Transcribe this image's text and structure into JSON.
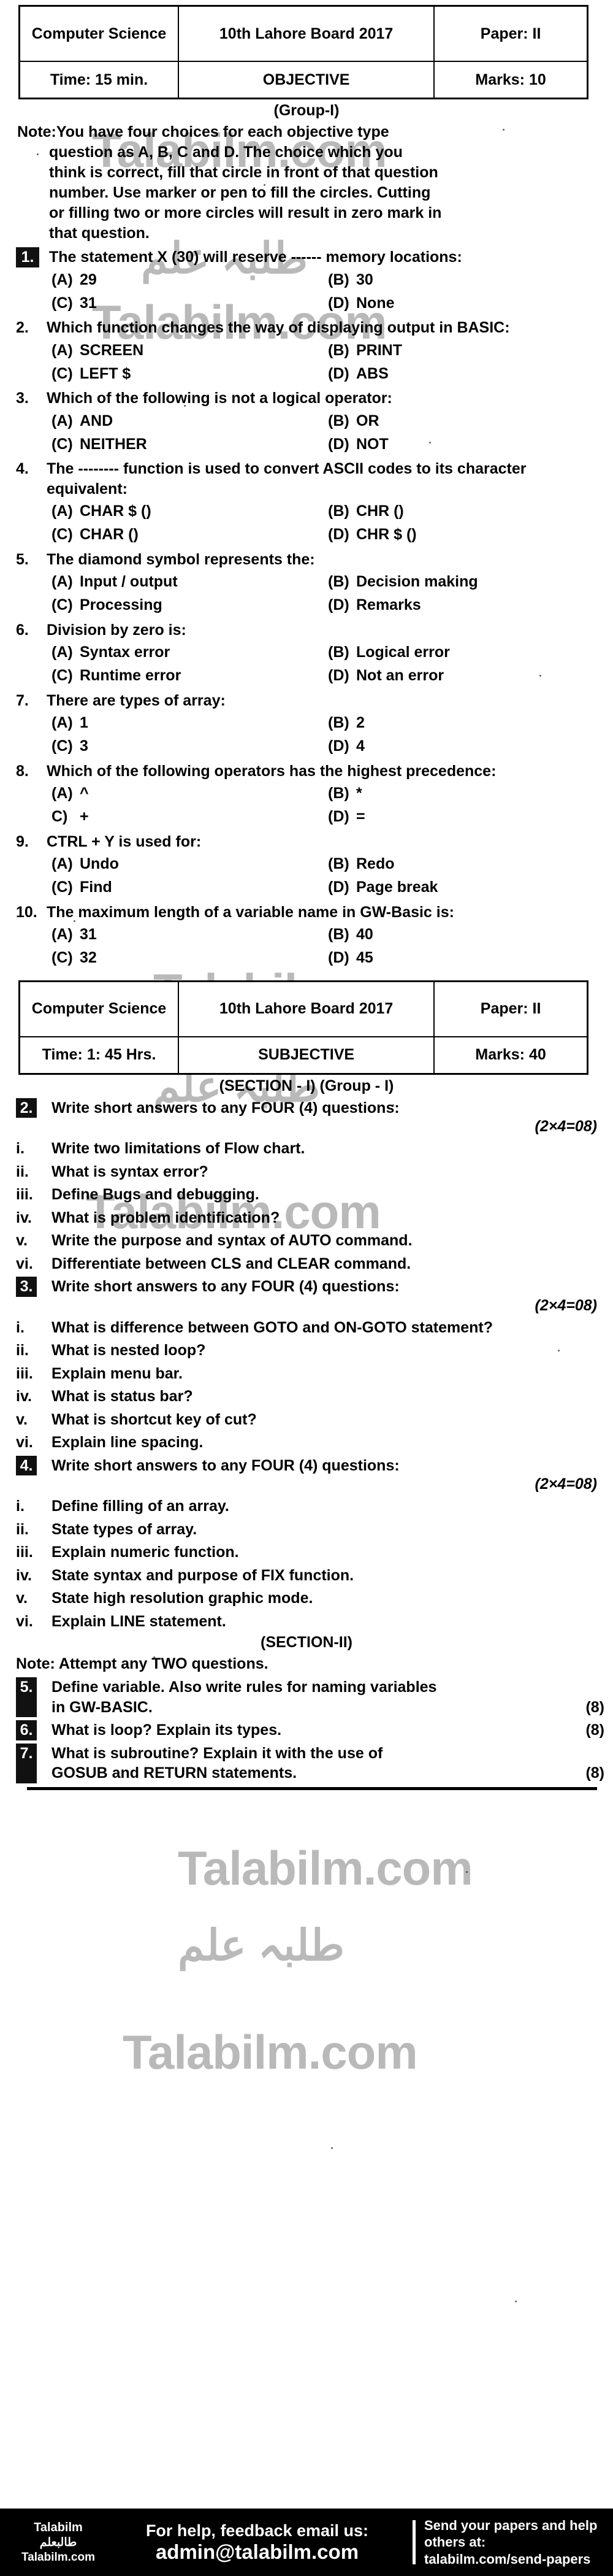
{
  "objective_header": {
    "subject": "Computer Science",
    "board": "10th Lahore Board 2017",
    "paper": "Paper: II",
    "time": "Time: 15 min.",
    "type": "OBJECTIVE",
    "marks": "Marks: 10",
    "group": "(Group-I)"
  },
  "note": {
    "line1": "Note:You have four choices for each objective type",
    "line2": "question as A, B, C and D. The choice which you",
    "line3": "think is correct, fill that circle in front of that question",
    "line4": "number. Use marker or pen to fill the circles. Cutting",
    "line5": "or filling two or more circles will result in zero mark in",
    "line6": "that question."
  },
  "mcqs": [
    {
      "num": "1.",
      "inverted": true,
      "text": "The statement X (30) will reserve ------ memory locations:",
      "options": [
        {
          "label": "(A)",
          "text": "29"
        },
        {
          "label": "(B)",
          "text": "30"
        },
        {
          "label": "(C)",
          "text": "31"
        },
        {
          "label": "(D)",
          "text": "None"
        }
      ]
    },
    {
      "num": "2.",
      "inverted": false,
      "text": "Which function changes the way of displaying output in BASIC:",
      "options": [
        {
          "label": "(A)",
          "text": "SCREEN"
        },
        {
          "label": "(B)",
          "text": "PRINT"
        },
        {
          "label": "(C)",
          "text": "LEFT $"
        },
        {
          "label": "(D)",
          "text": "ABS"
        }
      ]
    },
    {
      "num": "3.",
      "inverted": false,
      "text": "Which of the following is not a logical operator:",
      "options": [
        {
          "label": "(A)",
          "text": "AND"
        },
        {
          "label": "(B)",
          "text": "OR"
        },
        {
          "label": "(C)",
          "text": "NEITHER"
        },
        {
          "label": "(D)",
          "text": "NOT"
        }
      ]
    },
    {
      "num": "4.",
      "inverted": false,
      "text": "The -------- function is used to convert ASCII codes to its character equivalent:",
      "options": [
        {
          "label": "(A)",
          "text": "CHAR $ ()"
        },
        {
          "label": "(B)",
          "text": "CHR ()"
        },
        {
          "label": "(C)",
          "text": "CHAR ()"
        },
        {
          "label": "(D)",
          "text": "CHR $ ()"
        }
      ]
    },
    {
      "num": "5.",
      "inverted": false,
      "text": "The diamond symbol represents the:",
      "options": [
        {
          "label": "(A)",
          "text": "Input / output"
        },
        {
          "label": "(B)",
          "text": "Decision making"
        },
        {
          "label": "(C)",
          "text": "Processing"
        },
        {
          "label": "(D)",
          "text": "Remarks"
        }
      ]
    },
    {
      "num": "6.",
      "inverted": false,
      "text": "Division by zero is:",
      "options": [
        {
          "label": "(A)",
          "text": "Syntax error"
        },
        {
          "label": "(B)",
          "text": "Logical error"
        },
        {
          "label": "(C)",
          "text": "Runtime error"
        },
        {
          "label": "(D)",
          "text": "Not an error"
        }
      ]
    },
    {
      "num": "7.",
      "inverted": false,
      "text": "There are types of array:",
      "options": [
        {
          "label": "(A)",
          "text": "1"
        },
        {
          "label": "(B)",
          "text": "2"
        },
        {
          "label": "(C)",
          "text": "3"
        },
        {
          "label": "(D)",
          "text": "4"
        }
      ]
    },
    {
      "num": "8.",
      "inverted": false,
      "text": "Which of the following operators has the highest precedence:",
      "options": [
        {
          "label": "(A)",
          "text": "^"
        },
        {
          "label": "(B)",
          "text": "*"
        },
        {
          "label": "C)",
          "text": "+"
        },
        {
          "label": "(D)",
          "text": "="
        }
      ]
    },
    {
      "num": "9.",
      "inverted": false,
      "text": "CTRL + Y is used for:",
      "options": [
        {
          "label": "(A)",
          "text": "Undo"
        },
        {
          "label": "(B)",
          "text": "Redo"
        },
        {
          "label": "(C)",
          "text": "Find"
        },
        {
          "label": "(D)",
          "text": "Page break"
        }
      ]
    },
    {
      "num": "10.",
      "inverted": false,
      "text": "The maximum length of a variable name in GW-Basic is:",
      "options": [
        {
          "label": "(A)",
          "text": "31"
        },
        {
          "label": "(B)",
          "text": "40"
        },
        {
          "label": "(C)",
          "text": "32"
        },
        {
          "label": "(D)",
          "text": "45"
        }
      ]
    }
  ],
  "subjective_header": {
    "subject": "Computer Science",
    "board": "10th Lahore Board 2017",
    "paper": "Paper: II",
    "time": "Time: 1: 45 Hrs.",
    "type": "SUBJECTIVE",
    "marks": "Marks: 40",
    "section": "(SECTION - I) (Group - I)"
  },
  "subjective": [
    {
      "num": "2.",
      "stem": "Write short answers to any FOUR (4) questions:",
      "marks": "(2×4=08)",
      "items": [
        {
          "rn": "i.",
          "text": "Write two limitations of Flow chart."
        },
        {
          "rn": "ii.",
          "text": "What is syntax error?"
        },
        {
          "rn": "iii.",
          "text": "Define Bugs and debugging."
        },
        {
          "rn": "iv.",
          "text": "What is problem identification?"
        },
        {
          "rn": "v.",
          "text": "Write the purpose and syntax of AUTO command."
        },
        {
          "rn": "vi.",
          "text": "Differentiate between CLS and CLEAR command."
        }
      ]
    },
    {
      "num": "3.",
      "stem": "Write short answers to any FOUR (4) questions:",
      "marks": "(2×4=08)",
      "items": [
        {
          "rn": "i.",
          "text": "What is difference between GOTO and ON-GOTO statement?"
        },
        {
          "rn": "ii.",
          "text": "What is nested loop?"
        },
        {
          "rn": "iii.",
          "text": "Explain menu bar."
        },
        {
          "rn": "iv.",
          "text": "What is status bar?"
        },
        {
          "rn": "v.",
          "text": "What is shortcut key of cut?"
        },
        {
          "rn": "vi.",
          "text": "Explain line spacing."
        }
      ]
    },
    {
      "num": "4.",
      "stem": "Write short answers to any FOUR (4) questions:",
      "marks": "(2×4=08)",
      "items": [
        {
          "rn": "i.",
          "text": "Define filling of an array."
        },
        {
          "rn": "ii.",
          "text": "State types of array."
        },
        {
          "rn": "iii.",
          "text": "Explain numeric function."
        },
        {
          "rn": "iv.",
          "text": "State syntax and purpose of FIX function."
        },
        {
          "rn": "v.",
          "text": "State high resolution graphic mode."
        },
        {
          "rn": "vi.",
          "text": "Explain LINE statement."
        }
      ]
    }
  ],
  "section2": {
    "title": "(SECTION-II)",
    "note": "Note: Attempt any TWO questions.",
    "questions": [
      {
        "num": "5.",
        "line1": "Define variable. Also write rules for naming variables",
        "line2": "in GW-BASIC.",
        "marks": "(8)"
      },
      {
        "num": "6.",
        "line1": "What is loop? Explain its types.",
        "line2": "",
        "marks": "(8)"
      },
      {
        "num": "7.",
        "line1": "What is subroutine? Explain it with the use of",
        "line2": "GOSUB and RETURN statements.",
        "marks": "(8)"
      }
    ]
  },
  "watermarks": {
    "english": "Talabilm.com",
    "urdu": "طلبہ علم"
  },
  "footer": {
    "logo_line1": "Talabilm",
    "logo_line2": "طالبعلم",
    "logo_line3": "Talabilm.com",
    "mid_line1": "For help, feedback email us:",
    "mid_line2": "admin@talabilm.com",
    "right_line1": "Send your papers and help others at:",
    "right_line2": "talabilm.com/send-papers"
  }
}
